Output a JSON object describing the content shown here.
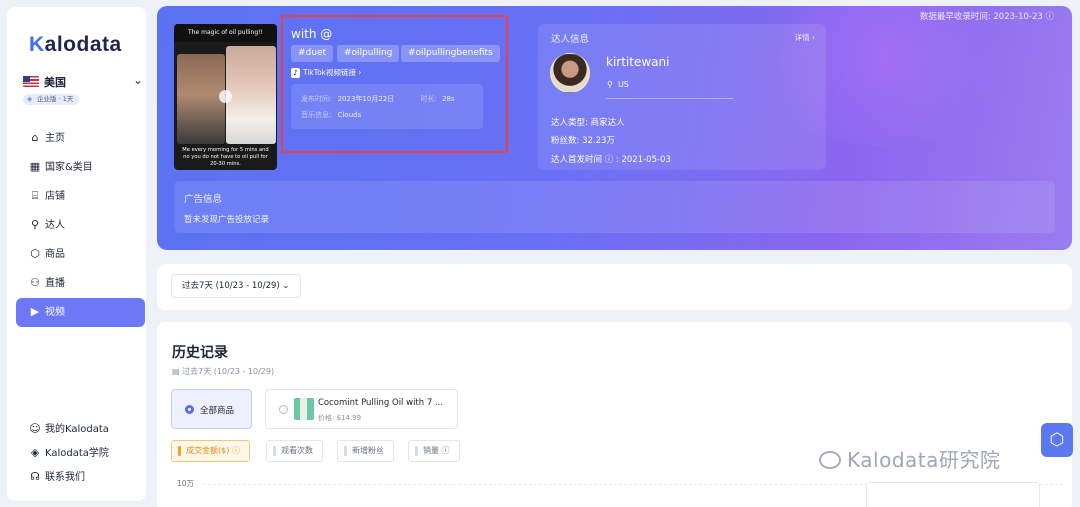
{
  "sidebar": {
    "logo": "Kalodata",
    "region": "美国",
    "plan": "企业版 · 1天",
    "nav": [
      {
        "label": "主页",
        "icon": "home-icon",
        "glyph": "⌂"
      },
      {
        "label": "国家&类目",
        "icon": "category-icon",
        "glyph": "▦"
      },
      {
        "label": "店铺",
        "icon": "shop-icon",
        "glyph": "⌸"
      },
      {
        "label": "达人",
        "icon": "creator-icon",
        "glyph": "⚲"
      },
      {
        "label": "商品",
        "icon": "product-icon",
        "glyph": "⬡"
      },
      {
        "label": "直播",
        "icon": "live-icon",
        "glyph": "⚇"
      },
      {
        "label": "视频",
        "icon": "video-icon",
        "glyph": "▶"
      }
    ],
    "bottom": [
      {
        "label": "我的Kalodata",
        "icon": "user-icon",
        "glyph": "☺"
      },
      {
        "label": "Kalodata学院",
        "icon": "academy-icon",
        "glyph": "◈"
      },
      {
        "label": "联系我们",
        "icon": "headset-icon",
        "glyph": "☊"
      }
    ]
  },
  "hero": {
    "record_time": "数据最早收录时间: 2023-10-23 ⓘ",
    "thumb_top": "The magic of oil pulling!!",
    "thumb_caption": "Me every morning for 5 mins and no you do not have to oil pull for 20-30 mins.",
    "video_title": "with @",
    "tags": [
      "#duet",
      "#oilpulling",
      "#oilpullingbenefits"
    ],
    "tiktok_link": "TikTok视频链接",
    "publish_label": "发布时间:",
    "publish_value": "2023年10月22日",
    "duration_label": "时长:",
    "duration_value": "28s",
    "music_label": "音乐信息:",
    "music_value": "Clouds",
    "creator": {
      "section_title": "达人信息",
      "detail_link": "详情",
      "name": "kirtitewani",
      "location": "US",
      "type": "达人类型: 商家达人",
      "followers": "粉丝数: 32.23万",
      "first_post": "达人首发时间 ⓘ : 2021-05-03"
    },
    "ads": {
      "title": "广告信息",
      "empty": "暂未发现广告投放记录"
    }
  },
  "filter": {
    "date_range": "过去7天 (10/23 - 10/29)"
  },
  "history": {
    "title": "历史记录",
    "subtitle": "过去7天 (10/23 - 10/29)",
    "all_products": "全部商品",
    "product_name": "Cocomint Pulling Oil with 7 ...",
    "product_price": "价格: $14.99",
    "metrics": [
      "成交金额($) ⓘ",
      "观看次数",
      "新增粉丝",
      "销量 ⓘ"
    ],
    "y_tick": "10万",
    "watermark": "Kalodata研究院"
  }
}
